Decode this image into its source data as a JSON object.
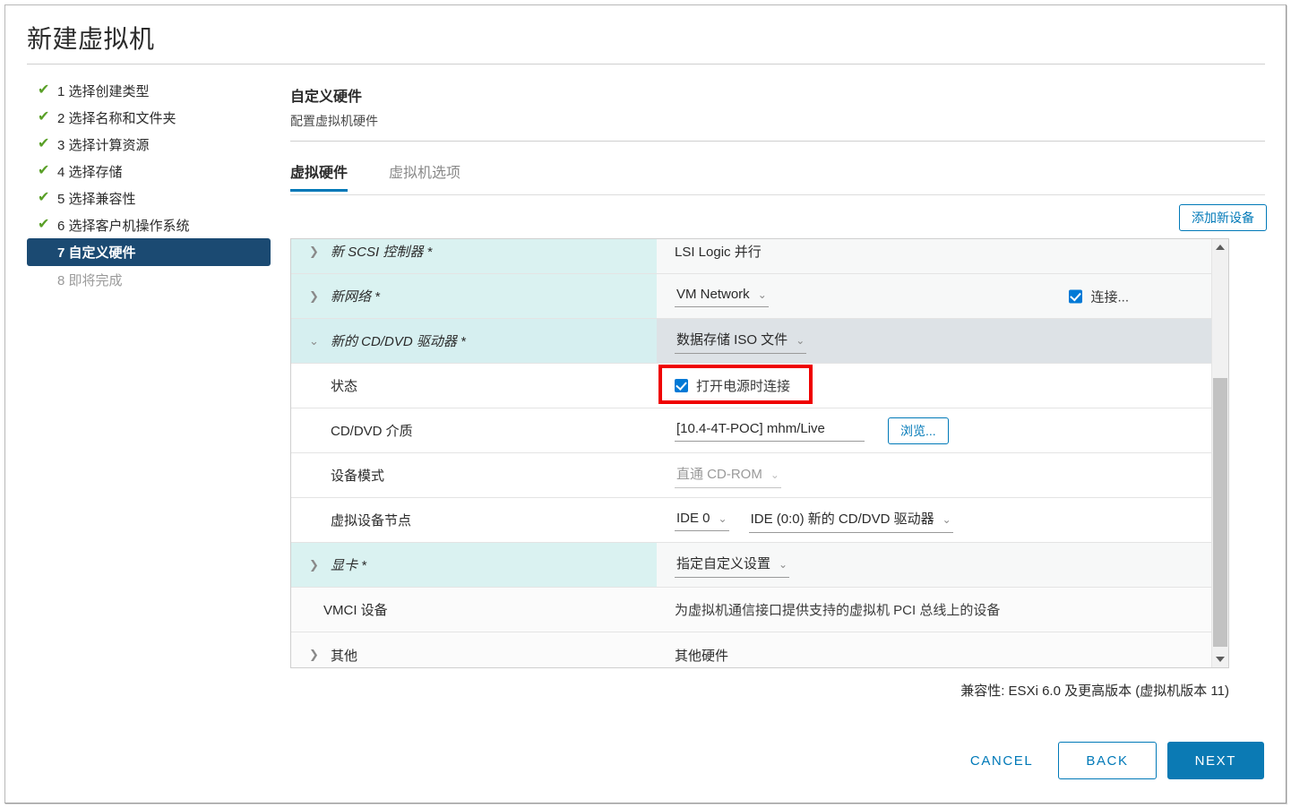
{
  "dialog": {
    "title": "新建虚拟机"
  },
  "sidebar": {
    "steps": [
      {
        "label": "1 选择创建类型",
        "state": "done"
      },
      {
        "label": "2 选择名称和文件夹",
        "state": "done"
      },
      {
        "label": "3 选择计算资源",
        "state": "done"
      },
      {
        "label": "4 选择存储",
        "state": "done"
      },
      {
        "label": "5 选择兼容性",
        "state": "done"
      },
      {
        "label": "6 选择客户机操作系统",
        "state": "done"
      },
      {
        "label": "7 自定义硬件",
        "state": "current"
      },
      {
        "label": "8 即将完成",
        "state": "upcoming"
      }
    ]
  },
  "main": {
    "section_title": "自定义硬件",
    "section_subtitle": "配置虚拟机硬件",
    "tabs": [
      {
        "label": "虚拟硬件",
        "active": true
      },
      {
        "label": "虚拟机选项",
        "active": false
      }
    ],
    "add_device_label": "添加新设备",
    "compatibility": "兼容性: ESXi 6.0 及更高版本 (虚拟机版本 11)"
  },
  "hardware": {
    "rows": [
      {
        "name": "新 SCSI 控制器 *",
        "value": "LSI Logic 并行",
        "caret": "right"
      },
      {
        "name": "新网络 *",
        "value": "VM Network",
        "caret": "right",
        "connect_label": "连接..."
      },
      {
        "name": "新的 CD/DVD 驱动器 *",
        "value": "数据存储 ISO 文件",
        "caret": "down"
      },
      {
        "name": "状态",
        "checkbox_label": "打开电源时连接"
      },
      {
        "name": "CD/DVD 介质",
        "value": "[10.4-4T-POC] mhm/Live",
        "browse_label": "浏览..."
      },
      {
        "name": "设备模式",
        "value": "直通 CD-ROM"
      },
      {
        "name": "虚拟设备节点",
        "value": "IDE 0",
        "value2": "IDE (0:0) 新的 CD/DVD 驱动器"
      },
      {
        "name": "显卡 *",
        "value": "指定自定义设置",
        "caret": "right"
      },
      {
        "name": "VMCI 设备",
        "value": "为虚拟机通信接口提供支持的虚拟机 PCI 总线上的设备"
      },
      {
        "name": "其他",
        "value": "其他硬件",
        "caret": "right"
      }
    ]
  },
  "footer": {
    "cancel": "CANCEL",
    "back": "BACK",
    "next": "NEXT"
  },
  "icons": {
    "check": "✔",
    "caret_right": "❯",
    "caret_down": "⌄",
    "chevron_down": "⌄"
  },
  "colors": {
    "accent": "#0079b8",
    "primary_button": "#0b7ab4",
    "step_current": "#1b4a72",
    "check_green": "#5aa028",
    "highlight_red": "#ef0000",
    "row_device_left": "#daf2f1",
    "row_selected_right": "#dde2e6"
  }
}
